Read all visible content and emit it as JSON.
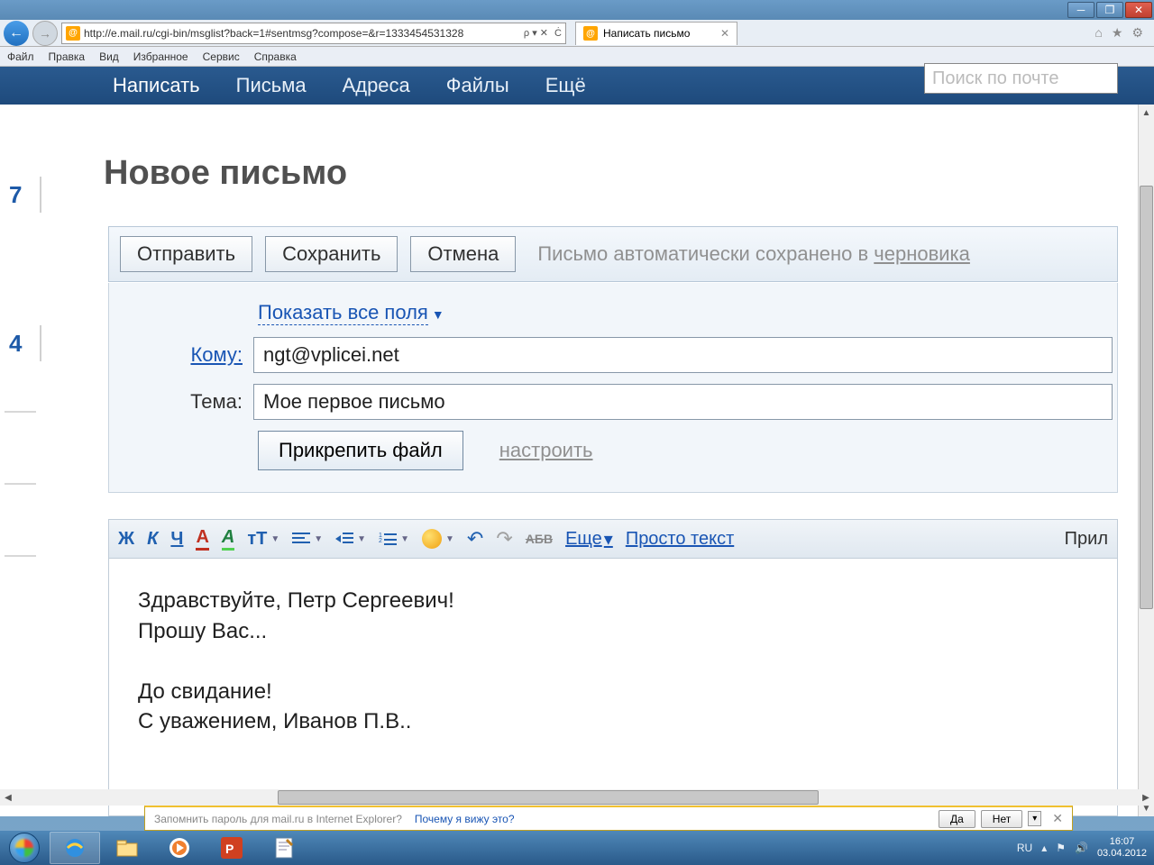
{
  "window": {
    "min": "─",
    "max": "❐",
    "close": "✕"
  },
  "ie": {
    "url": "http://e.mail.ru/cgi-bin/msglist?back=1#sentmsg?compose=&r=1333454531328",
    "search_ctrls": "ρ ▾ ✕",
    "refresh": "Ċ",
    "tab_title": "Написать письмо",
    "menu": [
      "Файл",
      "Правка",
      "Вид",
      "Избранное",
      "Сервис",
      "Справка"
    ]
  },
  "mailnav": {
    "items": [
      "Написать",
      "Письма",
      "Адреса",
      "Файлы",
      "Ещё"
    ],
    "search_placeholder": "Поиск по почте"
  },
  "sidenums": {
    "a": "7",
    "b": "4"
  },
  "page": {
    "title": "Новое письмо",
    "send": "Отправить",
    "save": "Сохранить",
    "cancel": "Отмена",
    "draft_note_1": "Письмо автоматически сохранено в ",
    "draft_note_2": "черновика",
    "show_all": "Показать все поля",
    "to_label": "Кому:",
    "to_value": "ngt@vplicei.net",
    "subj_label": "Тема:",
    "subj_value": "Мое первое письмо",
    "attach": "Прикрепить файл",
    "configure": "настроить"
  },
  "toolbar": {
    "bold": "Ж",
    "italic": "К",
    "underline": "Ч",
    "colorA": "А",
    "hiliteA": "А",
    "sizeT": "тТ",
    "strike": "АБВ",
    "more": "Еще",
    "plain": "Просто текст",
    "right": "Прил"
  },
  "body": {
    "l1": "Здравствуйте, Петр Сергеевич!",
    "l2": "Прошу Вас...",
    "l3": "До свидание!",
    "l4": "С уважением, Иванов П.В.."
  },
  "pwbar": {
    "q": "Запомнить пароль для mail.ru в Internet Explorer?",
    "why": "Почему я вижу это?",
    "yes": "Да",
    "no": "Нет"
  },
  "tray": {
    "lang": "RU",
    "time": "16:07",
    "date": "03.04.2012"
  }
}
